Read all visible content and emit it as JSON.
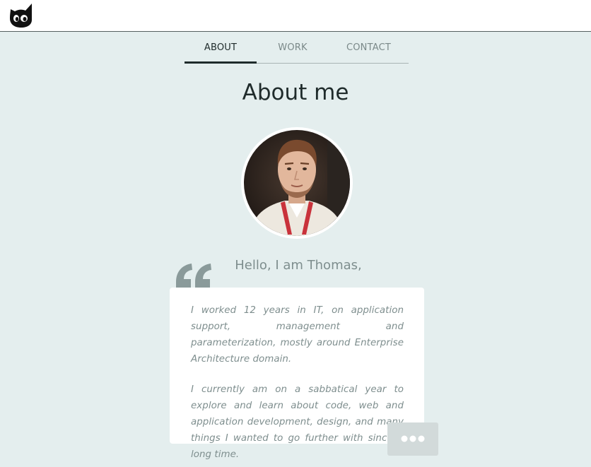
{
  "header": {
    "logo": "cat-head-logo"
  },
  "nav": {
    "tabs": [
      {
        "label": "ABOUT",
        "active": true
      },
      {
        "label": "WORK",
        "active": false
      },
      {
        "label": "CONTACT",
        "active": false
      }
    ]
  },
  "main": {
    "title": "About me",
    "avatar": "profile-photo",
    "greeting": "Hello, I am Thomas,",
    "quote_icon": "quote-mark-icon",
    "bio": {
      "paragraphs": [
        "I worked 12 years in IT, on application support, management and parameterization, mostly around Enterprise Architecture domain.",
        "I currently am on a sabbatical year to explore and learn about code, web and application development, design, and many things I wanted to go further with since a long time."
      ]
    },
    "more_icon": "ellipsis-icon"
  },
  "colors": {
    "background": "#e4eeee",
    "card": "#ffffff",
    "text_dark": "#1f2b2b",
    "text_muted": "#7e8e8e",
    "quote": "#8a9a9a",
    "more_button": "#d2dada"
  }
}
